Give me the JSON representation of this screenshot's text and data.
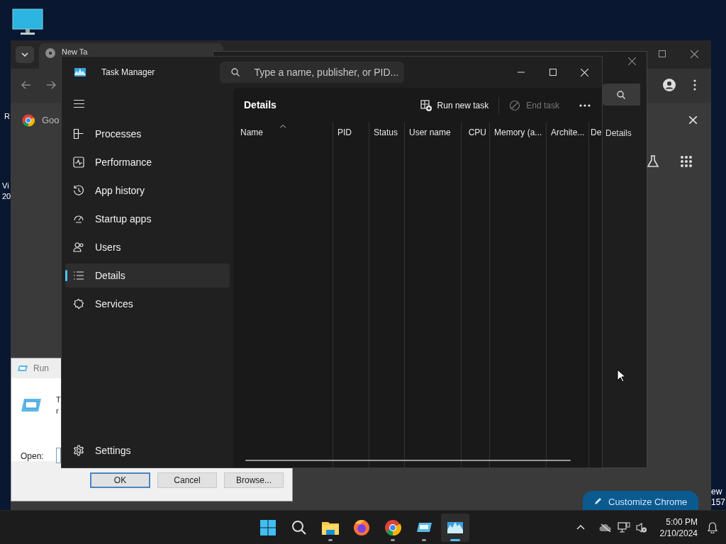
{
  "desktop": {
    "left_edge_texts": [
      "R",
      "Vi",
      "20"
    ],
    "right_edge_texts": [
      "ew",
      "157"
    ]
  },
  "browser": {
    "tab_title": "New Ta",
    "bookmark": "Goo",
    "customize_button": "Customize Chrome"
  },
  "background_window": {
    "heading": "Details"
  },
  "run_dialog": {
    "title": "Run",
    "description_lines": [
      "T",
      "r"
    ],
    "open_label": "Open:",
    "buttons": [
      {
        "label": "OK",
        "default": true
      },
      {
        "label": "Cancel",
        "default": false
      },
      {
        "label": "Browse...",
        "default": false
      }
    ]
  },
  "task_manager": {
    "title": "Task Manager",
    "search": {
      "placeholder": "Type a name, publisher, or PID..."
    },
    "nav": [
      {
        "label": "Processes",
        "kind": "processes",
        "selected": false
      },
      {
        "label": "Performance",
        "kind": "performance",
        "selected": false
      },
      {
        "label": "App history",
        "kind": "history",
        "selected": false
      },
      {
        "label": "Startup apps",
        "kind": "startup",
        "selected": false
      },
      {
        "label": "Users",
        "kind": "users",
        "selected": false
      },
      {
        "label": "Details",
        "kind": "details",
        "selected": true
      },
      {
        "label": "Services",
        "kind": "services",
        "selected": false
      }
    ],
    "settings": {
      "label": "Settings"
    },
    "page_title": "Details",
    "toolbar": [
      {
        "label": "Run new task",
        "kind": "run",
        "disabled": false
      },
      {
        "label": "End task",
        "kind": "end",
        "disabled": true
      }
    ],
    "columns": [
      {
        "label": "Name",
        "sorted": true
      },
      {
        "label": "PID",
        "sorted": false
      },
      {
        "label": "Status",
        "sorted": false
      },
      {
        "label": "User name",
        "sorted": false
      },
      {
        "label": "CPU",
        "sorted": false
      },
      {
        "label": "Memory (a...",
        "sorted": false
      },
      {
        "label": "Archite...",
        "sorted": false
      },
      {
        "label": "De",
        "sorted": false
      }
    ]
  },
  "taskbar": {
    "apps": [
      {
        "kind": "start",
        "running": false,
        "active": false
      },
      {
        "kind": "search",
        "running": false,
        "active": false
      },
      {
        "kind": "explorer",
        "running": true,
        "active": false
      },
      {
        "kind": "firefox",
        "running": false,
        "active": false
      },
      {
        "kind": "chrome",
        "running": true,
        "active": false
      },
      {
        "kind": "run",
        "running": true,
        "active": false
      },
      {
        "kind": "taskmanager",
        "running": true,
        "active": true
      }
    ],
    "clock": {
      "time": "5:00 PM",
      "date": "2/10/2024"
    }
  }
}
